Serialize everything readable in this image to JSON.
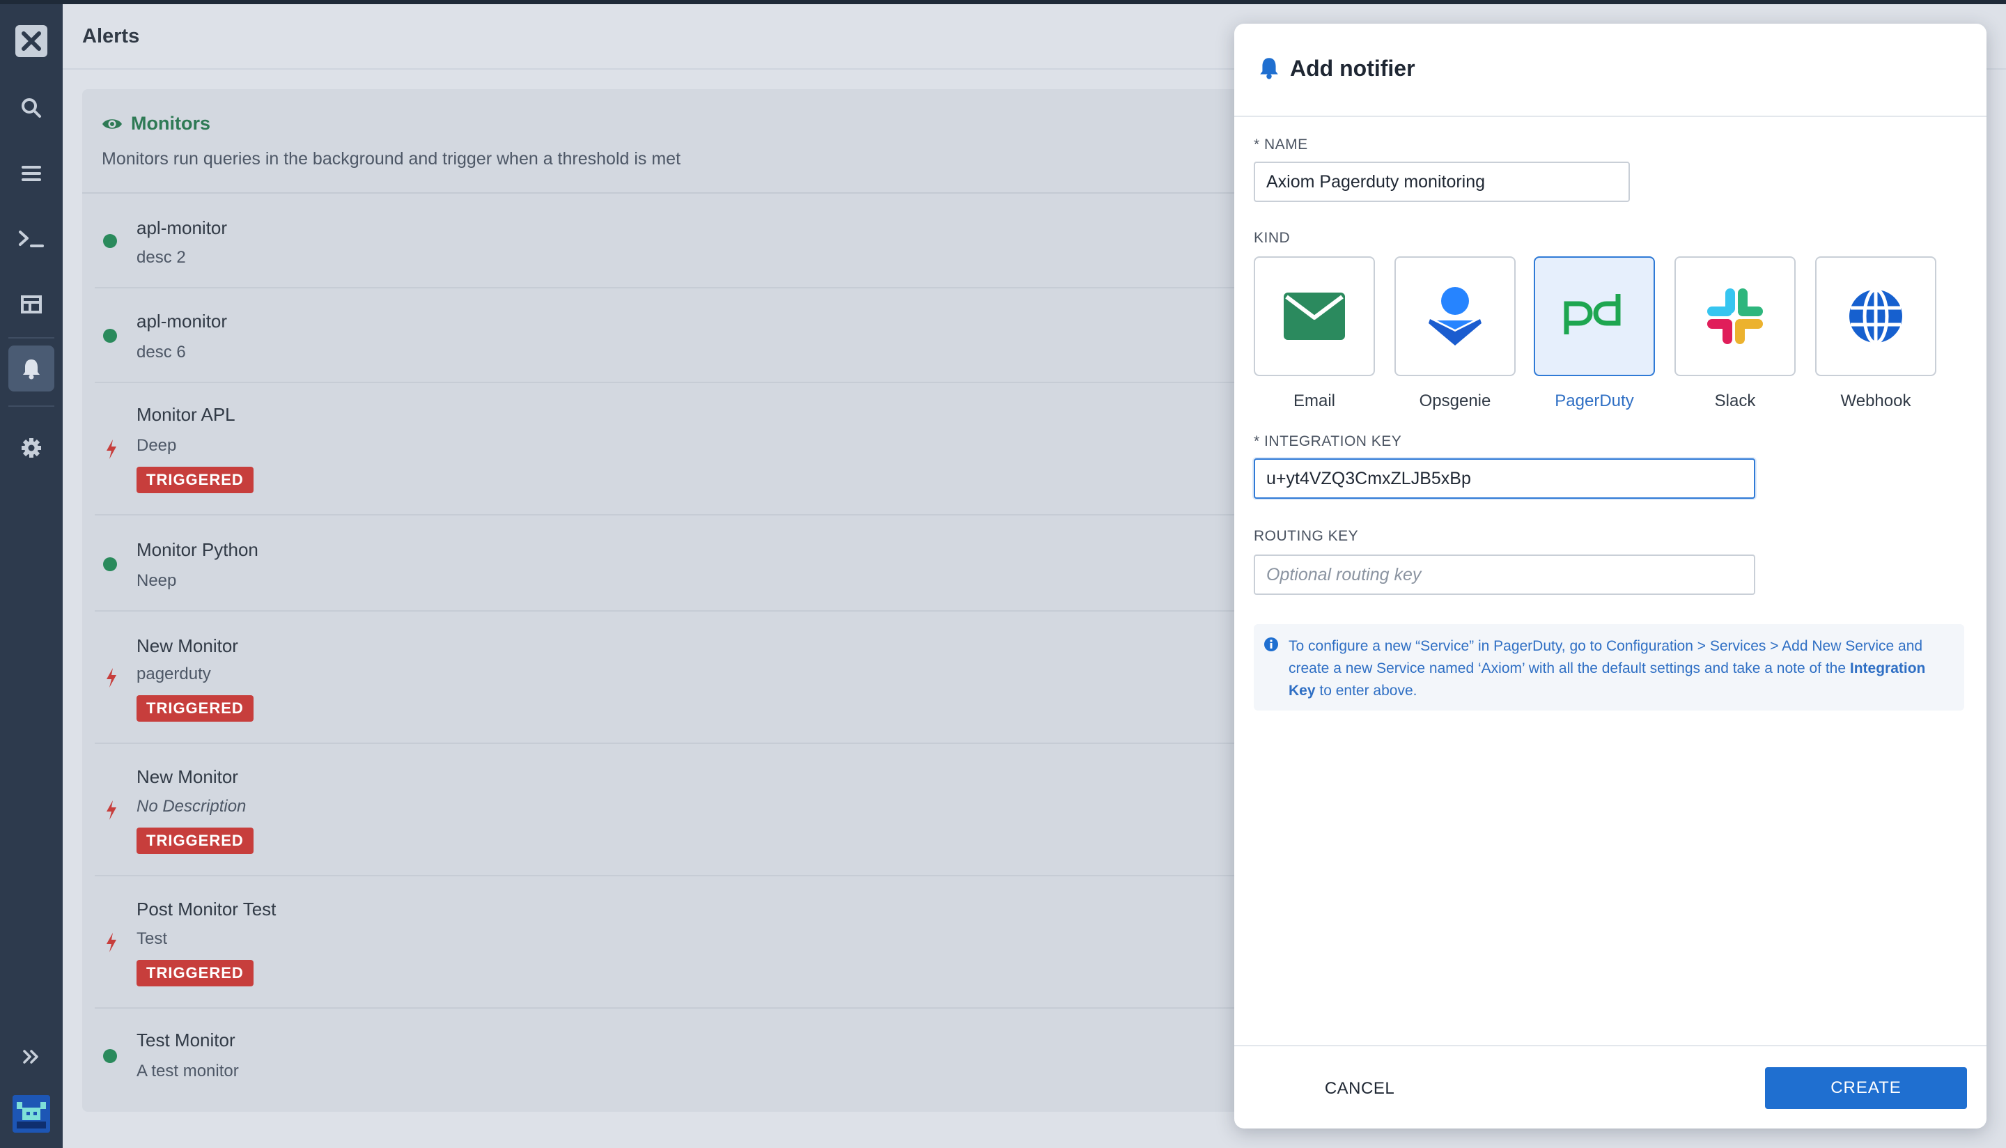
{
  "header": {
    "title": "Alerts"
  },
  "sidebar": {
    "items": [
      {
        "icon": "logo-icon"
      },
      {
        "icon": "search-icon"
      },
      {
        "icon": "stream-icon"
      },
      {
        "icon": "terminal-icon"
      },
      {
        "icon": "dashboard-icon"
      },
      {
        "icon": "bell-icon",
        "active": true
      },
      {
        "icon": "gear-icon"
      },
      {
        "icon": "expand-icon"
      },
      {
        "icon": "avatar"
      }
    ]
  },
  "monitors": {
    "title": "Monitors",
    "subtitle": "Monitors run queries in the background and trigger when a threshold is met",
    "items": [
      {
        "name": "apl-monitor",
        "desc": "desc 2",
        "status": "ok",
        "badge": ""
      },
      {
        "name": "apl-monitor",
        "desc": "desc 6",
        "status": "ok",
        "badge": ""
      },
      {
        "name": "Monitor APL",
        "desc": "Deep",
        "status": "triggered",
        "badge": "TRIGGERED"
      },
      {
        "name": "Monitor Python",
        "desc": "Neep",
        "status": "ok",
        "badge": ""
      },
      {
        "name": "New Monitor",
        "desc": "pagerduty",
        "status": "triggered",
        "badge": "TRIGGERED"
      },
      {
        "name": "New Monitor",
        "desc": "No Description",
        "status": "triggered",
        "badge": "TRIGGERED"
      },
      {
        "name": "Post Monitor Test",
        "desc": "Test",
        "status": "triggered",
        "badge": "TRIGGERED"
      },
      {
        "name": "Test Monitor",
        "desc": "A test monitor",
        "status": "ok",
        "badge": ""
      }
    ]
  },
  "modal": {
    "title": "Add notifier",
    "name_label": "* NAME",
    "name_value": "Axiom Pagerduty monitoring",
    "kind_label": "KIND",
    "kinds": [
      {
        "label": "Email",
        "icon": "envelope-icon",
        "selected": false
      },
      {
        "label": "Opsgenie",
        "icon": "opsgenie-icon",
        "selected": false
      },
      {
        "label": "PagerDuty",
        "icon": "pagerduty-icon",
        "selected": true
      },
      {
        "label": "Slack",
        "icon": "slack-icon",
        "selected": false
      },
      {
        "label": "Webhook",
        "icon": "globe-icon",
        "selected": false
      }
    ],
    "integration_label": "* INTEGRATION KEY",
    "integration_value": "u+yt4VZQ3CmxZLJB5xBp",
    "routing_label": "ROUTING KEY",
    "routing_placeholder": "Optional routing key",
    "info": {
      "part1": "To configure a new “Service” in PagerDuty, go to Configuration > Services > Add New Service and create a new Service named ‘Axiom’ with all the default settings and take a note of the ",
      "bold": "Integration Key",
      "part2": " to enter above."
    },
    "cancel_label": "CANCEL",
    "create_label": "CREATE"
  },
  "colors": {
    "sidebar": "#2d3a4d",
    "ok_dot": "#2a8a5c",
    "triggered": "#c73e3c",
    "accent": "#1f6fd0"
  }
}
